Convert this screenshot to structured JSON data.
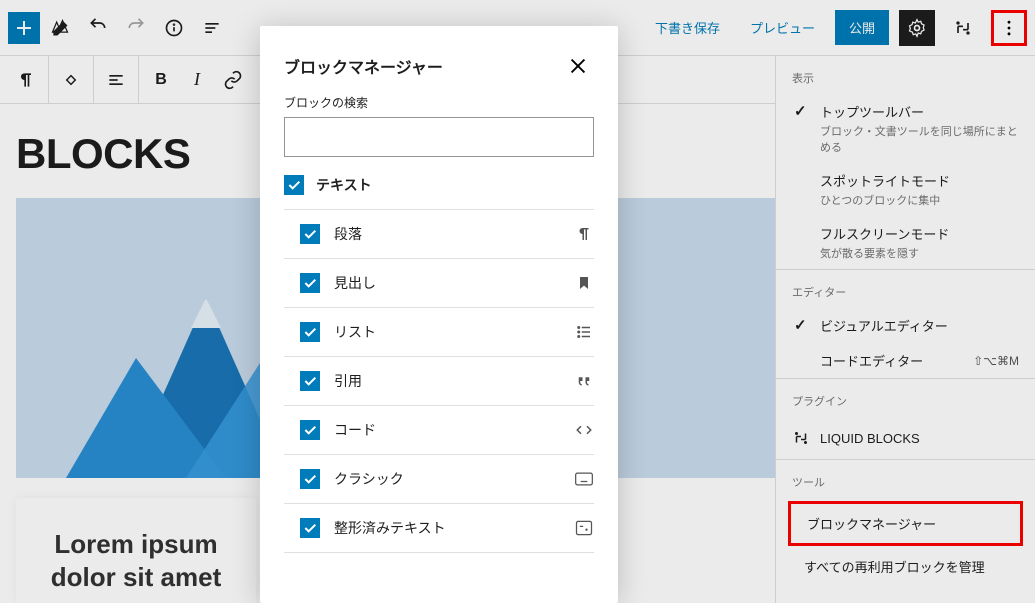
{
  "toolbar": {
    "save_draft": "下書き保存",
    "preview": "プレビュー",
    "publish": "公開"
  },
  "editor": {
    "title": "BLOCKS",
    "lorem": "Lorem ipsum dolor sit amet"
  },
  "side": {
    "s1_label": "表示",
    "s1_items": [
      {
        "title": "トップツールバー",
        "desc": "ブロック・文書ツールを同じ場所にまとめる",
        "checked": true
      },
      {
        "title": "スポットライトモード",
        "desc": "ひとつのブロックに集中",
        "checked": false
      },
      {
        "title": "フルスクリーンモード",
        "desc": "気が散る要素を隠す",
        "checked": false
      }
    ],
    "s2_label": "エディター",
    "s2_items": [
      {
        "title": "ビジュアルエディター",
        "checked": true,
        "shortcut": ""
      },
      {
        "title": "コードエディター",
        "checked": false,
        "shortcut": "⇧⌥⌘M"
      }
    ],
    "s3_label": "プラグイン",
    "s3_item": "LIQUID BLOCKS",
    "s4_label": "ツール",
    "s4_items": [
      "ブロックマネージャー",
      "すべての再利用ブロックを管理"
    ]
  },
  "modal": {
    "title": "ブロックマネージャー",
    "search_label": "ブロックの検索",
    "category": "テキスト",
    "items": [
      {
        "label": "段落",
        "icon": "pilcrow"
      },
      {
        "label": "見出し",
        "icon": "bookmark"
      },
      {
        "label": "リスト",
        "icon": "list"
      },
      {
        "label": "引用",
        "icon": "quote"
      },
      {
        "label": "コード",
        "icon": "code"
      },
      {
        "label": "クラシック",
        "icon": "keyboard"
      },
      {
        "label": "整形済みテキスト",
        "icon": "preformatted"
      }
    ]
  }
}
